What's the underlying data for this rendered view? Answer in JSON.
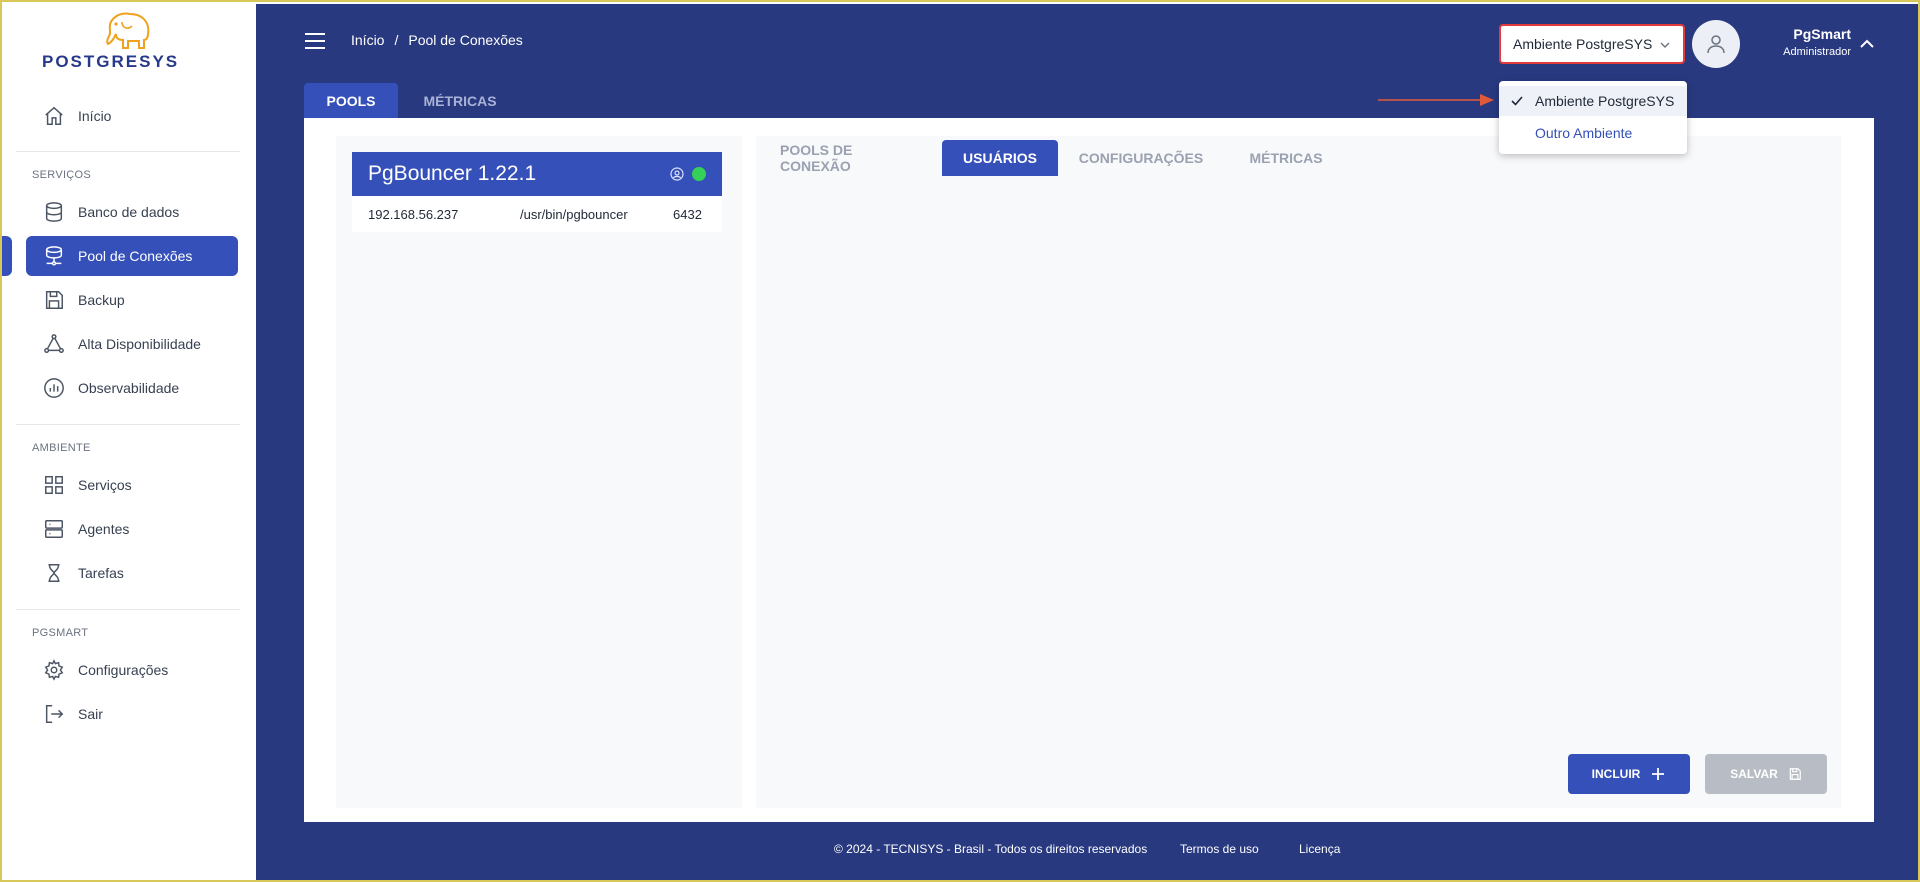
{
  "brand": {
    "logo_text": "POSTGRESYS"
  },
  "sidebar": {
    "home": "Início",
    "sections": [
      {
        "label": "SERVIÇOS",
        "items": [
          "Banco de dados",
          "Pool de Conexões",
          "Backup",
          "Alta Disponibilidade",
          "Observabilidade"
        ]
      },
      {
        "label": "AMBIENTE",
        "items": [
          "Serviços",
          "Agentes",
          "Tarefas"
        ]
      },
      {
        "label": "PGSMART",
        "items": [
          "Configurações",
          "Sair"
        ]
      }
    ],
    "active_item": "Pool de Conexões"
  },
  "header": {
    "breadcrumb": [
      "Início",
      "/",
      "Pool de Conexões"
    ],
    "environment": "Ambiente PostgreSYS",
    "user_name": "PgSmart",
    "user_role": "Administrador"
  },
  "main_tabs": [
    "POOLS",
    "MÉTRICAS"
  ],
  "pool": {
    "title": "PgBouncer 1.22.1",
    "ip": "192.168.56.237",
    "path": "/usr/bin/pgbouncer",
    "port": "6432",
    "status_color": "#34d058"
  },
  "sub_tabs": [
    "POOLS DE CONEXÃO",
    "USUÁRIOS",
    "CONFIGURAÇÕES",
    "MÉTRICAS"
  ],
  "active_sub_tab": "USUÁRIOS",
  "buttons": {
    "incluir": "INCLUIR",
    "salvar": "SALVAR"
  },
  "footer": {
    "copyright": "© 2024 - TECNISYS - Brasil - Todos os direitos reservados",
    "terms": "Termos de uso",
    "license": "Licença"
  },
  "environment_dropdown": {
    "options": [
      "Ambiente PostgreSYS",
      "Outro Ambiente"
    ],
    "selected": "Ambiente PostgreSYS"
  },
  "colors": {
    "primary": "#3550b8",
    "header_bg": "#28397f",
    "accent_arrow": "#e05a3a",
    "status_online": "#34d058",
    "select_border": "#e23b3b"
  }
}
